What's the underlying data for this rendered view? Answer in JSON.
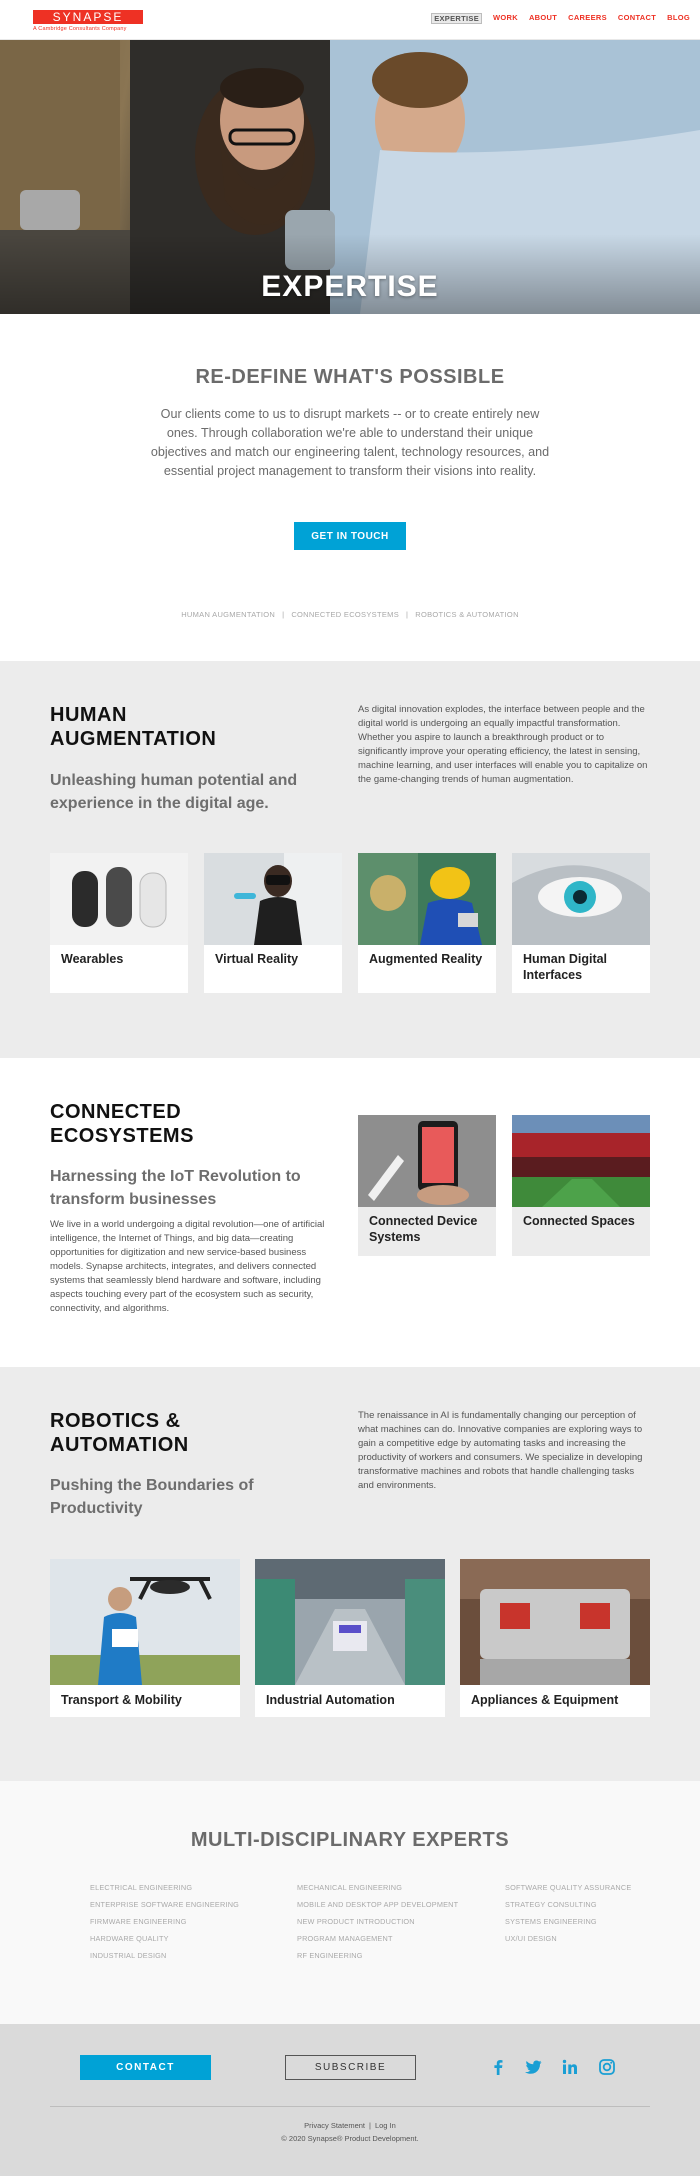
{
  "header": {
    "logo_text": "SYNAPSE",
    "logo_sub": "A Cambridge Consultants Company",
    "nav": [
      "EXPERTISE",
      "WORK",
      "ABOUT",
      "CAREERS",
      "CONTACT",
      "BLOG"
    ]
  },
  "hero": {
    "title": "EXPERTISE"
  },
  "intro": {
    "heading": "RE-DEFINE WHAT'S POSSIBLE",
    "text": "Our clients come to us to disrupt markets -- or to create entirely new ones. Through collaboration we're able to understand their unique objectives and match our engineering talent, technology resources, and essential project management to transform their visions into reality.",
    "cta": "GET IN TOUCH",
    "anchors": [
      "HUMAN AUGMENTATION",
      "CONNECTED ECOSYSTEMS",
      "ROBOTICS & AUTOMATION"
    ],
    "anchor_sep": "|"
  },
  "human": {
    "title": "HUMAN AUGMENTATION",
    "subtitle": "Unleashing human potential and experience in the digital age.",
    "text": "As digital innovation explodes, the interface between people and the digital world is undergoing an equally impactful transformation. Whether you aspire to launch a breakthrough product or to significantly improve your operating efficiency, the latest in sensing, machine learning, and user interfaces will enable you to capitalize on the game-changing trends of human augmentation.",
    "cards": [
      "Wearables",
      "Virtual Reality",
      "Augmented Reality",
      "Human Digital Interfaces"
    ]
  },
  "connected": {
    "title": "CONNECTED ECOSYSTEMS",
    "subtitle": "Harnessing the IoT Revolution to transform businesses",
    "text": "We live in a world undergoing a digital revolution—one of artificial intelligence, the Internet of Things, and big data—creating opportunities for digitization and new service-based business models. Synapse architects, integrates, and delivers connected systems that seamlessly blend hardware and software, including aspects touching every part of the ecosystem such as security, connectivity, and algorithms.",
    "cards": [
      "Connected Device Systems",
      "Connected Spaces"
    ]
  },
  "robotics": {
    "title": "ROBOTICS & AUTOMATION",
    "subtitle": "Pushing the Boundaries of Productivity",
    "text": "The renaissance in AI is fundamentally changing our perception of what machines can do. Innovative companies are exploring ways to gain a competitive edge by automating tasks and increasing the productivity of workers and consumers. We specialize in developing transformative machines and robots that handle challenging tasks and environments.",
    "cards": [
      "Transport & Mobility",
      "Industrial Automation",
      "Appliances & Equipment"
    ]
  },
  "experts": {
    "title": "MULTI-DISCIPLINARY EXPERTS",
    "col1": [
      "ELECTRICAL ENGINEERING",
      "ENTERPRISE SOFTWARE ENGINEERING",
      "FIRMWARE ENGINEERING",
      "HARDWARE QUALITY",
      "INDUSTRIAL DESIGN"
    ],
    "col2": [
      "MECHANICAL ENGINEERING",
      "MOBILE AND DESKTOP APP DEVELOPMENT",
      "NEW PRODUCT INTRODUCTION",
      "PROGRAM MANAGEMENT",
      "RF ENGINEERING"
    ],
    "col3": [
      "SOFTWARE QUALITY ASSURANCE",
      "STRATEGY CONSULTING",
      "SYSTEMS ENGINEERING",
      "UX/UI DESIGN"
    ]
  },
  "footer": {
    "contact": "CONTACT",
    "subscribe": "SUBSCRIBE",
    "privacy": "Privacy Statement",
    "sep": "|",
    "login": "Log In",
    "copyright": "© 2020 Synapse® Product Development."
  },
  "colors": {
    "brand_red": "#ee3124",
    "accent_blue": "#00a2d6",
    "social_blue": "#1a9fd4"
  },
  "icons": [
    "facebook-icon",
    "twitter-icon",
    "linkedin-icon",
    "instagram-icon"
  ]
}
